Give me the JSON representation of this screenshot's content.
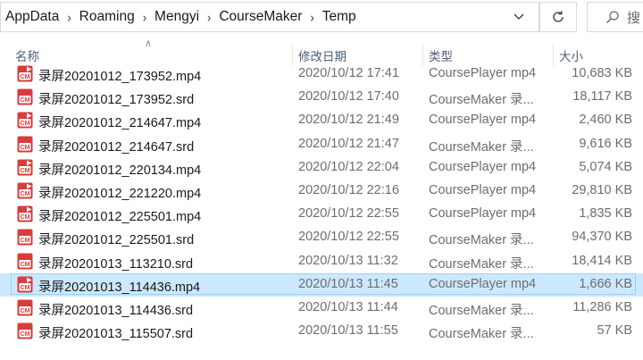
{
  "breadcrumb": [
    "AppData",
    "Roaming",
    "Mengyi",
    "CourseMaker",
    "Temp"
  ],
  "icons": {
    "separator": "chevron-right-icon",
    "dropdown": "chevron-down-icon",
    "refresh": "refresh-icon",
    "search": "search-icon",
    "file": "coursemaker-file-icon"
  },
  "search": {
    "placeholder": "搜"
  },
  "columns": {
    "name": "名称",
    "date": "修改日期",
    "type": "类型",
    "size": "大小"
  },
  "colors": {
    "accent_red": "#d83c3c",
    "selection_bg": "#cce8ff",
    "selection_border": "#99d1ff"
  },
  "files": [
    {
      "name": "录屏20201012_173952.mp4",
      "date": "2020/10/12 17:41",
      "type": "CoursePlayer mp4",
      "size": "10,683 KB",
      "kind": "mp4"
    },
    {
      "name": "录屏20201012_173952.srd",
      "date": "2020/10/12 17:40",
      "type": "CourseMaker 录...",
      "size": "18,117 KB",
      "kind": "srd"
    },
    {
      "name": "录屏20201012_214647.mp4",
      "date": "2020/10/12 21:49",
      "type": "CoursePlayer mp4",
      "size": "2,460 KB",
      "kind": "mp4"
    },
    {
      "name": "录屏20201012_214647.srd",
      "date": "2020/10/12 21:47",
      "type": "CourseMaker 录...",
      "size": "9,616 KB",
      "kind": "srd"
    },
    {
      "name": "录屏20201012_220134.mp4",
      "date": "2020/10/12 22:04",
      "type": "CoursePlayer mp4",
      "size": "5,074 KB",
      "kind": "mp4"
    },
    {
      "name": "录屏20201012_221220.mp4",
      "date": "2020/10/12 22:16",
      "type": "CoursePlayer mp4",
      "size": "29,810 KB",
      "kind": "mp4"
    },
    {
      "name": "录屏20201012_225501.mp4",
      "date": "2020/10/12 22:55",
      "type": "CoursePlayer mp4",
      "size": "1,835 KB",
      "kind": "mp4"
    },
    {
      "name": "录屏20201012_225501.srd",
      "date": "2020/10/12 22:55",
      "type": "CourseMaker 录...",
      "size": "94,370 KB",
      "kind": "srd"
    },
    {
      "name": "录屏20201013_113210.srd",
      "date": "2020/10/13 11:32",
      "type": "CourseMaker 录...",
      "size": "18,414 KB",
      "kind": "srd"
    },
    {
      "name": "录屏20201013_114436.mp4",
      "date": "2020/10/13 11:45",
      "type": "CoursePlayer mp4",
      "size": "1,666 KB",
      "kind": "mp4",
      "selected": true
    },
    {
      "name": "录屏20201013_114436.srd",
      "date": "2020/10/13 11:44",
      "type": "CourseMaker 录...",
      "size": "11,286 KB",
      "kind": "srd"
    },
    {
      "name": "录屏20201013_115507.srd",
      "date": "2020/10/13 11:55",
      "type": "CourseMaker 录...",
      "size": "57 KB",
      "kind": "srd"
    }
  ]
}
